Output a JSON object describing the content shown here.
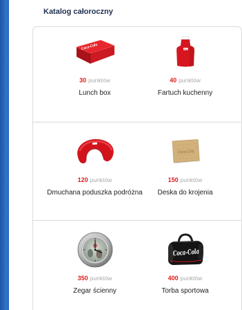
{
  "section_title": "Katalog całoroczny",
  "points_unit": "punktów",
  "brand_logo": "Coca-Cola",
  "colors": {
    "title": "#1f2f4f",
    "points": "#e21c1c",
    "points_unit": "#a8a8a8",
    "product_name": "#222222",
    "panel_border": "#dadada",
    "side_strip": "#2a67bb"
  },
  "products": [
    {
      "name": "Lunch box",
      "points": 30,
      "icon": "lunch-box-icon"
    },
    {
      "name": "Fartuch kuchenny",
      "points": 40,
      "icon": "apron-icon"
    },
    {
      "name": "Dmuchana poduszka podróżna",
      "points": 120,
      "icon": "neck-pillow-icon"
    },
    {
      "name": "Deska do krojenia",
      "points": 150,
      "icon": "cutting-board-icon"
    },
    {
      "name": "Zegar ścienny",
      "points": 350,
      "icon": "wall-clock-icon"
    },
    {
      "name": "Torba sportowa",
      "points": 400,
      "icon": "sports-bag-icon"
    }
  ]
}
